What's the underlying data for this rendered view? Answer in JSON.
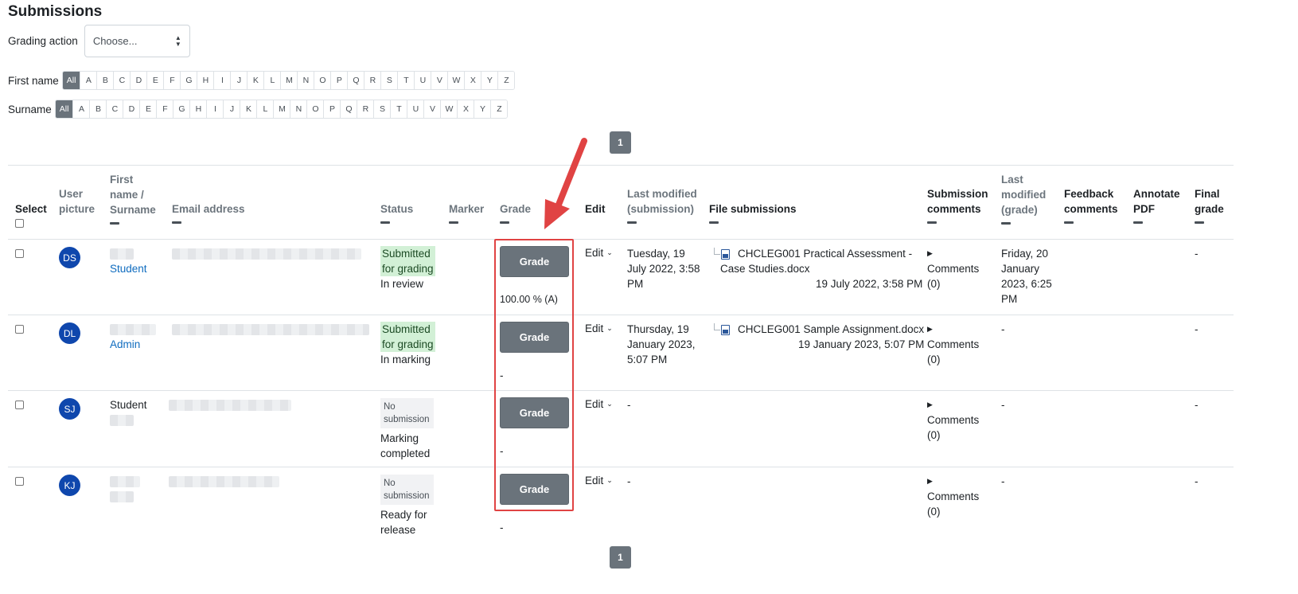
{
  "page_title": "Submissions",
  "grading_action": {
    "label": "Grading action",
    "value": "Choose..."
  },
  "first_name_filter": {
    "label": "First name",
    "letters": [
      "All",
      "A",
      "B",
      "C",
      "D",
      "E",
      "F",
      "G",
      "H",
      "I",
      "J",
      "K",
      "L",
      "M",
      "N",
      "O",
      "P",
      "Q",
      "R",
      "S",
      "T",
      "U",
      "V",
      "W",
      "X",
      "Y",
      "Z"
    ],
    "active": "All"
  },
  "surname_filter": {
    "label": "Surname",
    "letters": [
      "All",
      "A",
      "B",
      "C",
      "D",
      "E",
      "F",
      "G",
      "H",
      "I",
      "J",
      "K",
      "L",
      "M",
      "N",
      "O",
      "P",
      "Q",
      "R",
      "S",
      "T",
      "U",
      "V",
      "W",
      "X",
      "Y",
      "Z"
    ],
    "active": "All"
  },
  "pagination": {
    "page": "1"
  },
  "columns": {
    "select": "Select",
    "user_picture_1": "User",
    "user_picture_2": "picture",
    "name_1": "First",
    "name_2": "name /",
    "name_3": "Surname",
    "email": "Email address",
    "status": "Status",
    "marker": "Marker",
    "grade": "Grade",
    "edit": "Edit",
    "last_modified_sub_1": "Last modified",
    "last_modified_sub_2": "(submission)",
    "file_submissions": "File submissions",
    "sub_comments_1": "Submission",
    "sub_comments_2": "comments",
    "last_mod_grade_1": "Last",
    "last_mod_grade_2": "modified",
    "last_mod_grade_3": "(grade)",
    "feedback_1": "Feedback",
    "feedback_2": "comments",
    "annotate_1": "Annotate",
    "annotate_2": "PDF",
    "final_1": "Final",
    "final_2": "grade"
  },
  "rows": [
    {
      "initials": "DS",
      "name_line2": "Student",
      "status_1": "Submitted",
      "status_2": "for grading",
      "status_3": "In review",
      "grade_btn": "Grade",
      "grade_value": "100.00 % (A)",
      "edit": "Edit",
      "modified_1": "Tuesday, 19",
      "modified_2": "July 2022, 3:58",
      "modified_3": "PM",
      "file_1": "CHCLEG001 Practical Assessment -",
      "file_2": "Case Studies.docx",
      "file_date": "19 July 2022, 3:58 PM",
      "comments_1": "Comments",
      "comments_2": "(0)",
      "grade_mod_1": "Friday, 20",
      "grade_mod_2": "January",
      "grade_mod_3": "2023, 6:25",
      "grade_mod_4": "PM",
      "final": "-"
    },
    {
      "initials": "DL",
      "name_line2": "Admin",
      "status_1": "Submitted",
      "status_2": "for grading",
      "status_3": "In marking",
      "grade_btn": "Grade",
      "grade_value": "-",
      "edit": "Edit",
      "modified_1": "Thursday, 19",
      "modified_2": "January 2023,",
      "modified_3": "5:07 PM",
      "file_1": "CHCLEG001 Sample Assignment.docx",
      "file_date": "19 January 2023, 5:07 PM",
      "comments_1": "Comments",
      "comments_2": "(0)",
      "grade_mod_1": "-",
      "final": "-"
    },
    {
      "initials": "SJ",
      "name_line1": "Student",
      "status_1": "No",
      "status_2": "submission",
      "status_3": "Marking",
      "status_4": "completed",
      "grade_btn": "Grade",
      "grade_value": "-",
      "edit": "Edit",
      "modified_1": "-",
      "comments_1": "Comments",
      "comments_2": "(0)",
      "grade_mod_1": "-",
      "final": "-"
    },
    {
      "initials": "KJ",
      "status_1": "No",
      "status_2": "submission",
      "status_3": "Ready for",
      "status_4": "release",
      "grade_btn": "Grade",
      "grade_value": "-",
      "edit": "Edit",
      "modified_1": "-",
      "comments_1": "Comments",
      "comments_2": "(0)",
      "grade_mod_1": "-",
      "final": "-"
    }
  ]
}
